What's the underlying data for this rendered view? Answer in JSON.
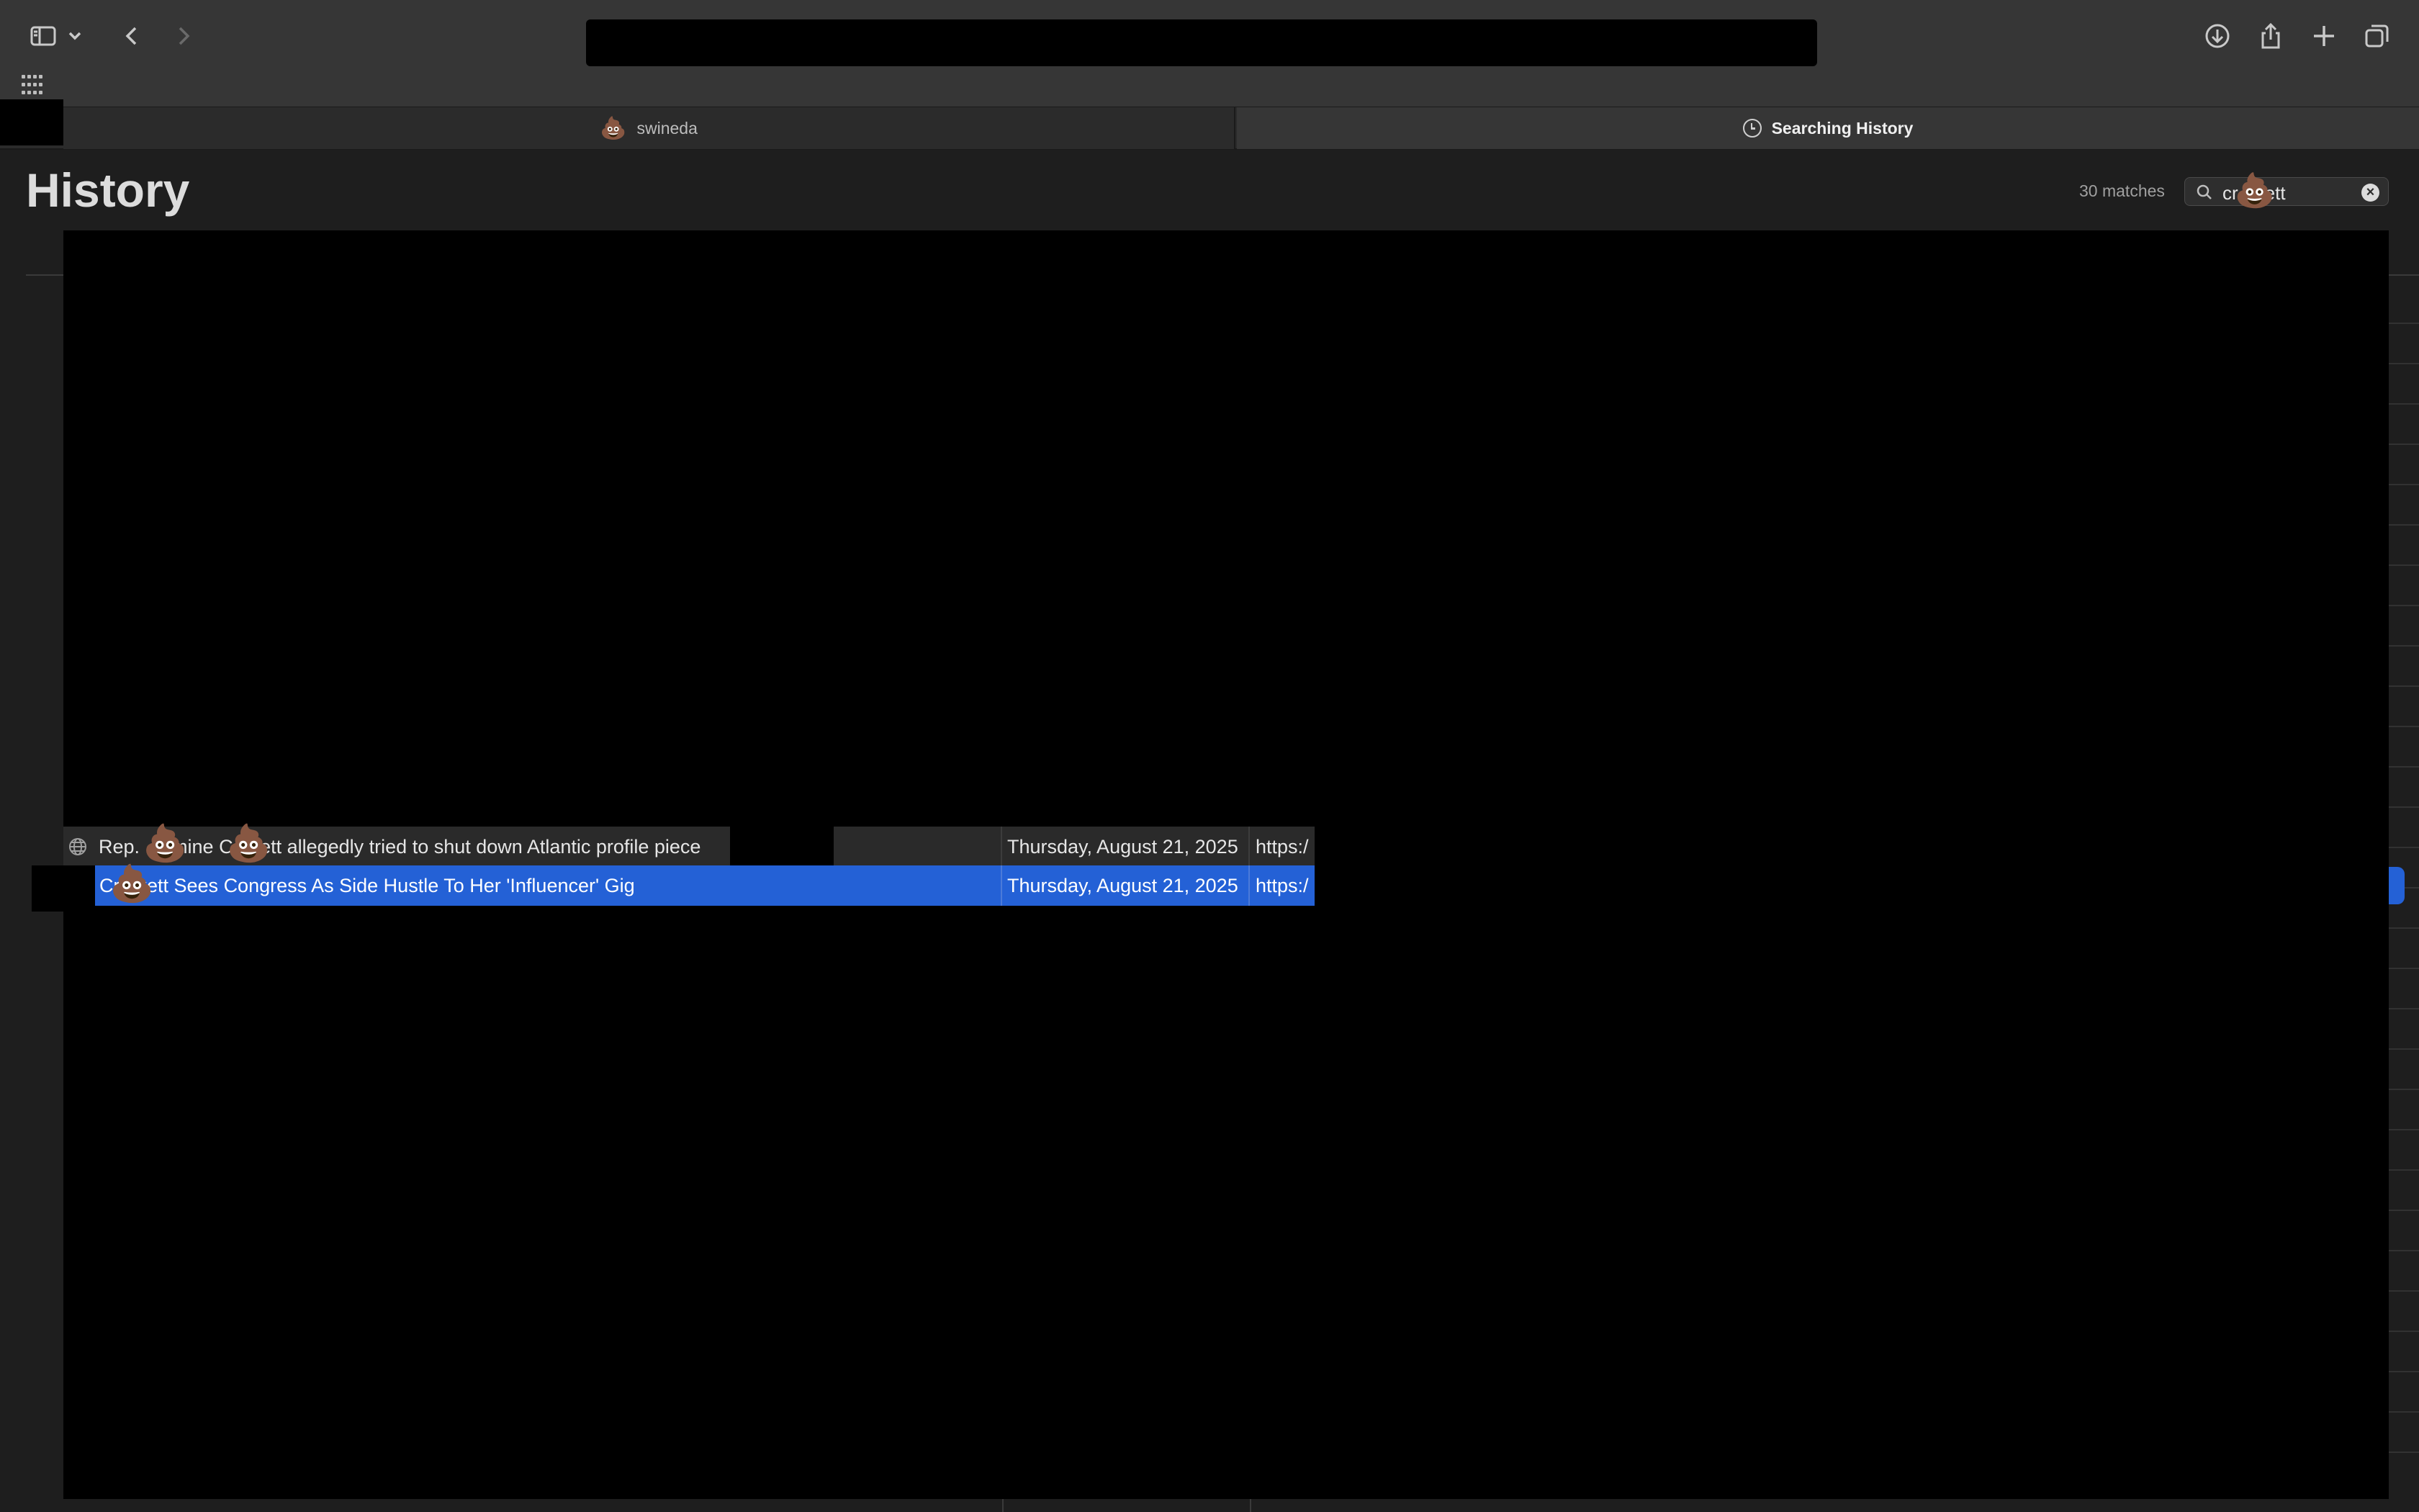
{
  "toolbar": {
    "icons": [
      "sidebar-icon",
      "chevron-down-icon",
      "back-icon",
      "forward-icon",
      "download-icon",
      "share-icon",
      "plus-icon",
      "tabs-overview-icon"
    ],
    "apps_icon": "grid-icon"
  },
  "tabs": [
    {
      "label": "swineda",
      "icon": "💩",
      "active": false
    },
    {
      "label": "Searching History",
      "icon": "clock-icon",
      "active": true
    }
  ],
  "header": {
    "title": "History",
    "matches": "30 matches",
    "search": {
      "value": "crockett",
      "prefix": "cr",
      "suffix": "kett",
      "emoji": "💩"
    }
  },
  "rows": [
    {
      "title_parts": [
        "Rep. ",
        "mine C",
        "kett allegedly tried to shut down Atlantic profile piece"
      ],
      "date": "Thursday, August 21, 2025",
      "url": "https:/",
      "selected": false,
      "icon": "globe-icon"
    },
    {
      "title_parts": [
        "Cr",
        "kett Sees Congress As Side Hustle To Her 'Influencer' Gig"
      ],
      "date": "Thursday, August 21, 2025",
      "url": "https:/",
      "selected": true
    }
  ],
  "emoji": "💩",
  "colors": {
    "background": "#1e1e1e",
    "toolbar": "#363636",
    "selection": "#2461d6",
    "redaction": "#000000"
  }
}
